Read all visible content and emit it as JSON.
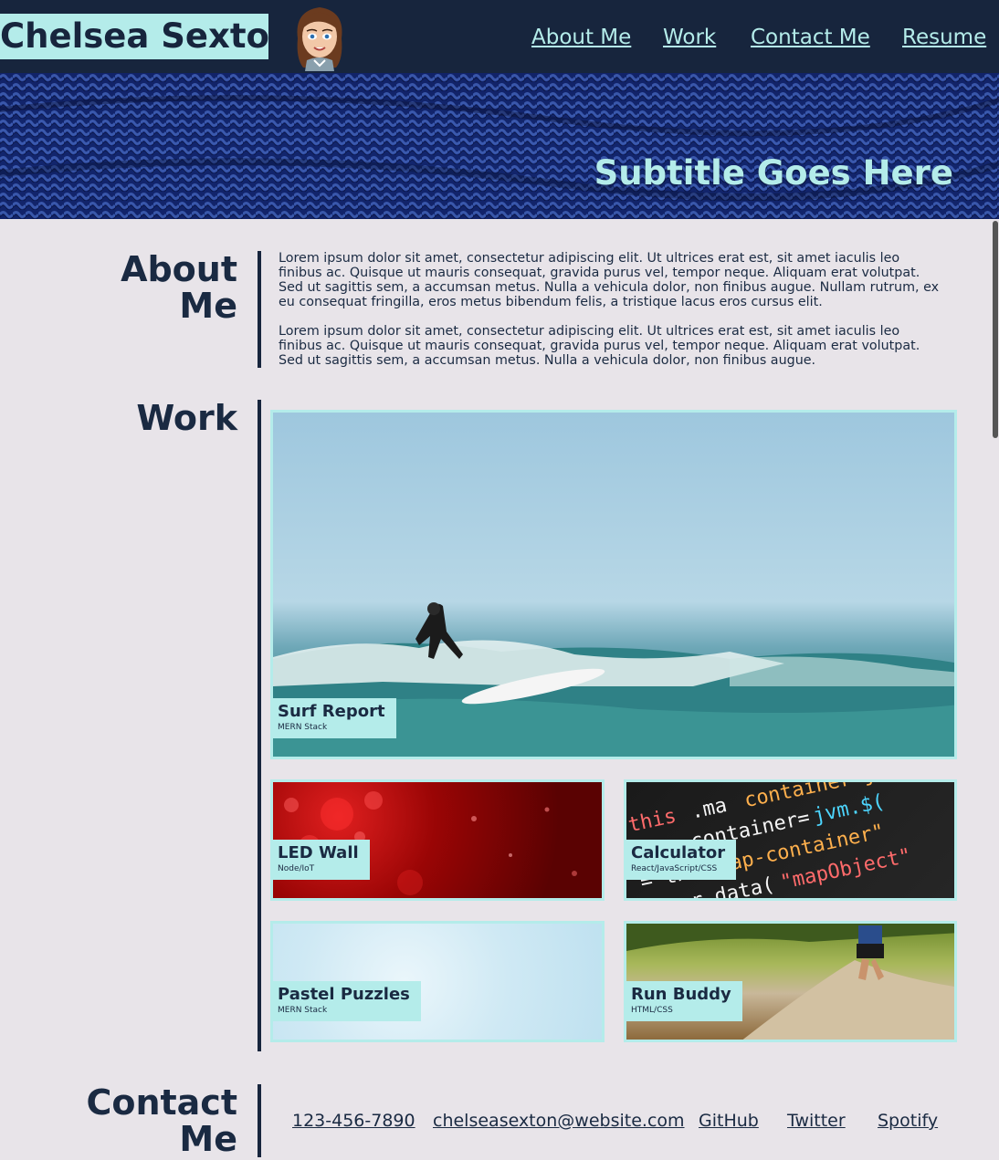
{
  "header": {
    "brand": "Chelsea Sexton",
    "nav": [
      {
        "label": "About Me"
      },
      {
        "label": "Work"
      },
      {
        "label": "Contact Me"
      },
      {
        "label": "Resume"
      }
    ]
  },
  "hero": {
    "subtitle": "Subtitle Goes Here"
  },
  "about": {
    "title": "About Me",
    "paragraphs": [
      "Lorem ipsum dolor sit amet, consectetur adipiscing elit. Ut ultrices erat est, sit amet iaculis leo finibus ac. Quisque ut mauris consequat, gravida purus vel, tempor neque. Aliquam erat volutpat. Sed ut sagittis sem, a accumsan metus. Nulla a vehicula dolor, non finibus augue. Nullam rutrum, ex eu consequat fringilla, eros metus bibendum felis, a tristique lacus eros cursus elit.",
      "Lorem ipsum dolor sit amet, consectetur adipiscing elit. Ut ultrices erat est, sit amet iaculis leo finibus ac. Quisque ut mauris consequat, gravida purus vel, tempor neque. Aliquam erat volutpat. Sed ut sagittis sem, a accumsan metus. Nulla a vehicula dolor, non finibus augue."
    ]
  },
  "work": {
    "title": "Work",
    "projects": [
      {
        "title": "Surf Report",
        "stack": "MERN Stack"
      },
      {
        "title": "LED Wall",
        "stack": "Node/IoT"
      },
      {
        "title": "Calculator",
        "stack": "React/JavaScript/CSS"
      },
      {
        "title": "Pastel Puzzles",
        "stack": "MERN Stack"
      },
      {
        "title": "Run Buddy",
        "stack": "HTML/CSS"
      }
    ]
  },
  "contact": {
    "title": "Contact Me",
    "links": [
      {
        "label": "123-456-7890"
      },
      {
        "label": "chelseasexton@website.com"
      },
      {
        "label": "GitHub"
      },
      {
        "label": "Twitter"
      },
      {
        "label": "Spotify"
      }
    ]
  },
  "colors": {
    "navy": "#17253d",
    "accent": "#b4ecea",
    "background": "#e8e4e9"
  }
}
